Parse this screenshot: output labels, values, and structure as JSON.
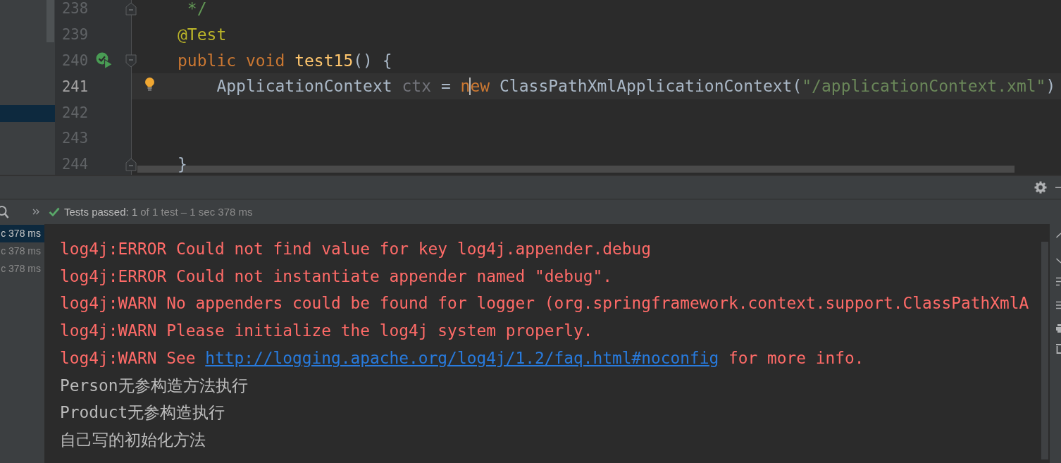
{
  "editor": {
    "lines": [
      {
        "number": "238",
        "current": false,
        "icons": [
          {
            "kind": "fold-end"
          }
        ],
        "tokens": [
          {
            "text": " */",
            "kind": "comment"
          }
        ]
      },
      {
        "number": "239",
        "current": false,
        "tokens": [
          {
            "text": "@Test",
            "kind": "annotation"
          }
        ]
      },
      {
        "number": "240",
        "current": false,
        "icons": [
          {
            "kind": "run-passed"
          },
          {
            "kind": "fold-start"
          }
        ],
        "tokens": [
          {
            "text": "public void ",
            "kind": "keyword"
          },
          {
            "text": "test15",
            "kind": "method"
          },
          {
            "text": "() {",
            "kind": "plain"
          }
        ]
      },
      {
        "number": "241",
        "current": true,
        "icons": [
          {
            "kind": "bulb"
          }
        ],
        "tokens": [
          {
            "text": "    ApplicationContext ",
            "kind": "plain"
          },
          {
            "text": "ctx",
            "kind": "unused"
          },
          {
            "text": " = ",
            "kind": "plain"
          },
          {
            "text": "n",
            "kind": "keyword"
          },
          {
            "kind": "caret"
          },
          {
            "text": "ew",
            "kind": "keyword"
          },
          {
            "text": " ClassPathXmlApplicationContext(",
            "kind": "plain"
          },
          {
            "text": "\"/applicationContext.xml\"",
            "kind": "string"
          },
          {
            "text": ")",
            "kind": "plain"
          }
        ]
      },
      {
        "number": "242",
        "current": false
      },
      {
        "number": "243",
        "current": false
      },
      {
        "number": "244",
        "current": false,
        "icons": [
          {
            "kind": "fold-end"
          }
        ],
        "tokens": [
          {
            "text": "}",
            "kind": "plain"
          }
        ]
      }
    ]
  },
  "run_panel": {
    "status": {
      "summary": "Tests passed: 1",
      "detail": "of 1 test – 1 sec 378 ms"
    },
    "test_tree": {
      "rows": [
        {
          "text": "c 378 ms",
          "selected": true
        },
        {
          "text": "c 378 ms",
          "selected": false
        },
        {
          "text": "c 378 ms",
          "selected": false
        }
      ]
    },
    "console": {
      "lines": [
        {
          "kind": "error",
          "text": "log4j:ERROR Could not find value for key log4j.appender.debug"
        },
        {
          "kind": "error",
          "text": "log4j:ERROR Could not instantiate appender named \"debug\"."
        },
        {
          "kind": "error",
          "text": "log4j:WARN No appenders could be found for logger (org.springframework.context.support.ClassPathXmlA"
        },
        {
          "kind": "error",
          "text": "log4j:WARN Please initialize the log4j system properly."
        },
        {
          "kind": "error",
          "text": "log4j:WARN See ",
          "link": "http://logging.apache.org/log4j/1.2/faq.html#noconfig",
          "tail": " for more info."
        },
        {
          "kind": "output",
          "text": "Person无参构造方法执行"
        },
        {
          "kind": "output",
          "text": "Product无参构造执行"
        },
        {
          "kind": "output",
          "text": "自己写的初始化方法"
        }
      ]
    }
  }
}
